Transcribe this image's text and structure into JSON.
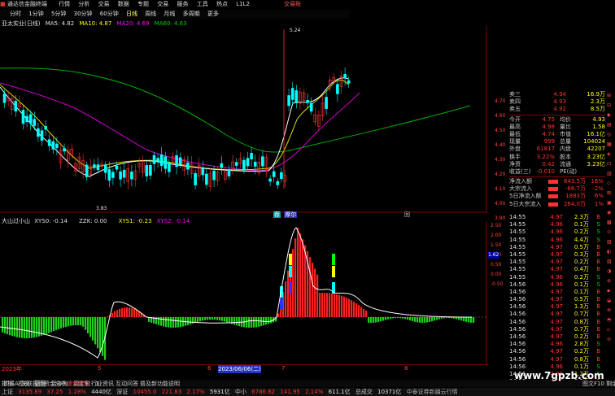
{
  "menubar": {
    "app_title": "通达信金融终端",
    "items": [
      "行情",
      "分析",
      "交易",
      "数据",
      "专题",
      "交易",
      "服务",
      "工具",
      "热点",
      "L1L2"
    ],
    "trade": "交易账"
  },
  "toolbar": {
    "items": [
      "分时",
      "1分钟",
      "5分钟",
      "30分钟",
      "60分钟",
      "日线",
      "周线",
      "月线",
      "多周期",
      "更多"
    ]
  },
  "kline": {
    "title": "亚太实业(日线)",
    "ma5": "MA5: 4.82",
    "ma10": "MA10: 4.87",
    "ma20": "MA20: 4.69",
    "ma60": "MA60: 4.63",
    "high_label": "5.24",
    "low_label": "3.83",
    "tags": [
      "荐",
      "摩尔"
    ],
    "tag2": "回",
    "colors": {
      "up": "#ff3333",
      "down": "#00ffff",
      "ma5": "#ffffff",
      "ma10": "#ffff00",
      "ma20": "#ff00ff",
      "ma60": "#00c000"
    }
  },
  "indicator": {
    "title": "大山过小山",
    "xys0": "XYS0: -0.14",
    "zzk": "ZZK: 0.00",
    "xys1": "XYS1: -0.23",
    "xys2": "XYS2: -0.14"
  },
  "xaxis": {
    "left_label": "2023年",
    "m1": "5",
    "m2": "6",
    "date": "2023/06/06(二)",
    "m3": "7",
    "m4": "8"
  },
  "quote": {
    "sell": [
      {
        "name": "卖三",
        "price": "4.94",
        "vol": "16.9万"
      },
      {
        "name": "卖四",
        "price": "4.93",
        "vol": "2.3万"
      },
      {
        "name": "卖五",
        "price": "4.92",
        "vol": "8.5万"
      }
    ],
    "stats": [
      {
        "l1": "今开",
        "v1": "4.75",
        "l2": "均价",
        "v2": "4.93"
      },
      {
        "l1": "最高",
        "v1": "4.98",
        "l2": "量比",
        "v2": "1.58"
      },
      {
        "l1": "最低",
        "v1": "4.74",
        "l2": "市值",
        "v2": "16.1亿"
      },
      {
        "l1": "现量",
        "v1": "999",
        "l2": "总量",
        "v2": "104024"
      },
      {
        "l1": "外盘",
        "v1": "61817",
        "l2": "内盘",
        "v2": "42207"
      },
      {
        "l1": "换手",
        "v1": "3.22%",
        "l2": "股本",
        "v2": "3.23亿"
      },
      {
        "l1": "净资",
        "v1": "0.42",
        "l2": "流通",
        "v2": "3.23亿"
      },
      {
        "l1": "收益(三)",
        "v1": "-0.010",
        "l2": "PE(动)",
        "v2": ""
      }
    ],
    "flows": [
      {
        "label": "净流入额",
        "value": "843.5万",
        "pct": "16%"
      },
      {
        "label": "大宗流入",
        "value": "-86.7万",
        "pct": "-2%"
      },
      {
        "label": "5日净流入额",
        "value": "1883万",
        "pct": "6%"
      },
      {
        "label": "5日大宗流入",
        "value": "284.0万",
        "pct": "1%"
      }
    ],
    "side_prices": [
      "4.70",
      "4.60",
      "4.50",
      "4.40",
      "4.30",
      "4.20",
      "4.10",
      "4.00",
      "3.90"
    ],
    "mid_price": "1.62"
  },
  "ticks": [
    {
      "t": "14:55",
      "p": "4.97",
      "v": "2.3万",
      "d": "B"
    },
    {
      "t": "14:55",
      "p": "4.96",
      "p_c": "red",
      "v": "0.1万",
      "d": "S"
    },
    {
      "t": "14:55",
      "p": "4.96",
      "v": "0.2万",
      "d": "S"
    },
    {
      "t": "14:55",
      "p": "4.96",
      "v": "4.4万",
      "d": "S"
    },
    {
      "t": "14:55",
      "p": "4.97",
      "v": "0.5万",
      "d": "B"
    },
    {
      "t": "14:55",
      "p": "4.97",
      "v": "0.3万",
      "d": "B"
    },
    {
      "t": "14:55",
      "p": "4.97",
      "v": "0.2万",
      "d": "B"
    },
    {
      "t": "14:55",
      "p": "4.97",
      "v": "0.4万",
      "d": "B"
    },
    {
      "t": "14:55",
      "p": "4.96",
      "v": "0.2万",
      "d": "S"
    },
    {
      "t": "14:56",
      "p": "4.96",
      "v": "0.1万",
      "d": "S"
    },
    {
      "t": "14:56",
      "p": "4.97",
      "v": "0.1万",
      "d": "B"
    },
    {
      "t": "14:56",
      "p": "4.97",
      "v": "0.5万",
      "d": "B"
    },
    {
      "t": "14:56",
      "p": "4.97",
      "v": "1.3万",
      "d": "B"
    },
    {
      "t": "14:56",
      "p": "4.97",
      "v": "0.7万",
      "d": "B"
    },
    {
      "t": "14:56",
      "p": "4.97",
      "v": "0.8万",
      "d": "B"
    },
    {
      "t": "14:56",
      "p": "4.97",
      "v": "0.7万",
      "d": "B"
    },
    {
      "t": "14:56",
      "p": "4.97",
      "v": "0.2万",
      "d": "B"
    },
    {
      "t": "14:56",
      "p": "4.96",
      "v": "2.8万",
      "d": "S"
    },
    {
      "t": "14:56",
      "p": "4.97",
      "v": "0.2万",
      "d": "B"
    },
    {
      "t": "14:56",
      "p": "4.97",
      "v": "0.8万",
      "d": "B"
    },
    {
      "t": "14:56",
      "p": "4.96",
      "v": "0.1万",
      "d": "S"
    },
    {
      "t": "14:56",
      "p": "4.96",
      "v": "1.2万",
      "d": "S"
    },
    {
      "t": "14:56",
      "p": "4.97",
      "v": "0.2万",
      "d": "B"
    }
  ],
  "bottombar": {
    "items": [
      "指标",
      "模板",
      "管理",
      "另存为",
      "调定制",
      "1"
    ]
  },
  "statusbar2": {
    "items": [
      "扩展A",
      "关联报价",
      "资金分布",
      "综合资讯",
      "行业资讯",
      "互动问答",
      "普及新功能说明"
    ]
  },
  "status": {
    "sh_label": "上证",
    "sh_val": "3135.89",
    "sh_chg": "37.25",
    "sh_pct": "1.28%",
    "sh_amt": "4440亿",
    "sz_label": "深证",
    "sz_val": "10455.0",
    "sz_chg": "221.83",
    "sz_pct": "2.17%",
    "sz_amt": "5931亿",
    "zx_label": "中小",
    "zx_val": "6786.82",
    "zx_chg": "141.95",
    "zx_pct": "2.14%",
    "zx_amt": "611.1亿",
    "zs_label": "总成交",
    "zs_amt": "10371亿",
    "tail": "中泰证券新疆云行情"
  },
  "watermark": "www.7gpzb.com",
  "corner": "图文F10 剩余"
}
